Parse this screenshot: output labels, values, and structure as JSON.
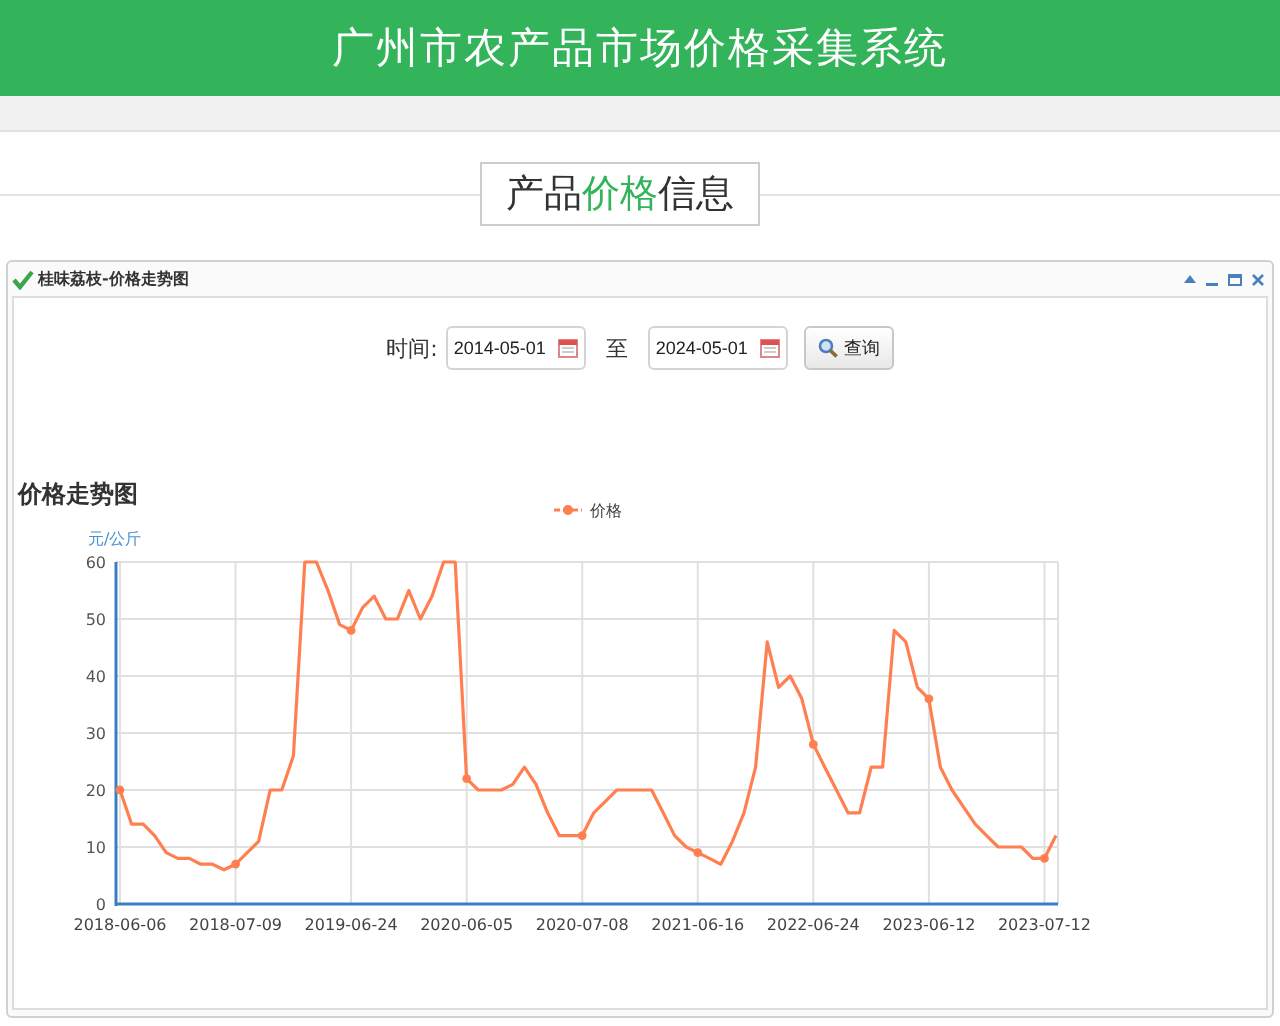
{
  "header": {
    "title": "广州市农产品市场价格采集系统"
  },
  "section_title": [
    {
      "text": "产品",
      "highlight": false
    },
    {
      "text": "价格",
      "highlight": true
    },
    {
      "text": "信息",
      "highlight": false
    }
  ],
  "panel": {
    "title": "桂味荔枝-价格走势图",
    "filter": {
      "label": "时间:",
      "from": {
        "value": "2014-05-01"
      },
      "separator": "至",
      "to": {
        "value": "2024-05-01"
      },
      "button": "查询"
    },
    "chart_title": "价格走势图",
    "chart_data": {
      "type": "line",
      "grid": true,
      "ylabel": "元/公斤",
      "ylim": [
        0,
        60
      ],
      "yticks": [
        0,
        10,
        20,
        30,
        40,
        50,
        60
      ],
      "categories": [
        "2018-06-06",
        null,
        null,
        null,
        null,
        null,
        null,
        null,
        null,
        null,
        "2018-07-09",
        null,
        null,
        null,
        null,
        null,
        null,
        null,
        null,
        null,
        "2019-06-24",
        null,
        null,
        null,
        null,
        null,
        null,
        null,
        null,
        null,
        "2020-06-05",
        null,
        null,
        null,
        null,
        null,
        null,
        null,
        null,
        null,
        "2020-07-08",
        null,
        null,
        null,
        null,
        null,
        null,
        null,
        null,
        null,
        "2021-06-16",
        null,
        null,
        null,
        null,
        null,
        null,
        null,
        null,
        null,
        "2022-06-24",
        null,
        null,
        null,
        null,
        null,
        null,
        null,
        null,
        null,
        "2023-06-12",
        null,
        null,
        null,
        null,
        null,
        null,
        null,
        null,
        null,
        "2023-07-12",
        null
      ],
      "series": [
        {
          "name": "价格",
          "color": "#ff7f50",
          "values": [
            20,
            14,
            14,
            12,
            9,
            8,
            8,
            7,
            7,
            6,
            7,
            9,
            11,
            20,
            20,
            26,
            60,
            60,
            55,
            49,
            48,
            52,
            54,
            50,
            50,
            55,
            50,
            54,
            60,
            60,
            22,
            20,
            20,
            20,
            21,
            24,
            21,
            16,
            12,
            12,
            12,
            16,
            18,
            20,
            20,
            20,
            20,
            16,
            12,
            10,
            9,
            8,
            7,
            11,
            16,
            24,
            46,
            38,
            40,
            36,
            28,
            24,
            20,
            16,
            16,
            24,
            24,
            48,
            46,
            38,
            36,
            24,
            20,
            17,
            14,
            12,
            10,
            10,
            10,
            8,
            8,
            12
          ]
        }
      ]
    }
  }
}
